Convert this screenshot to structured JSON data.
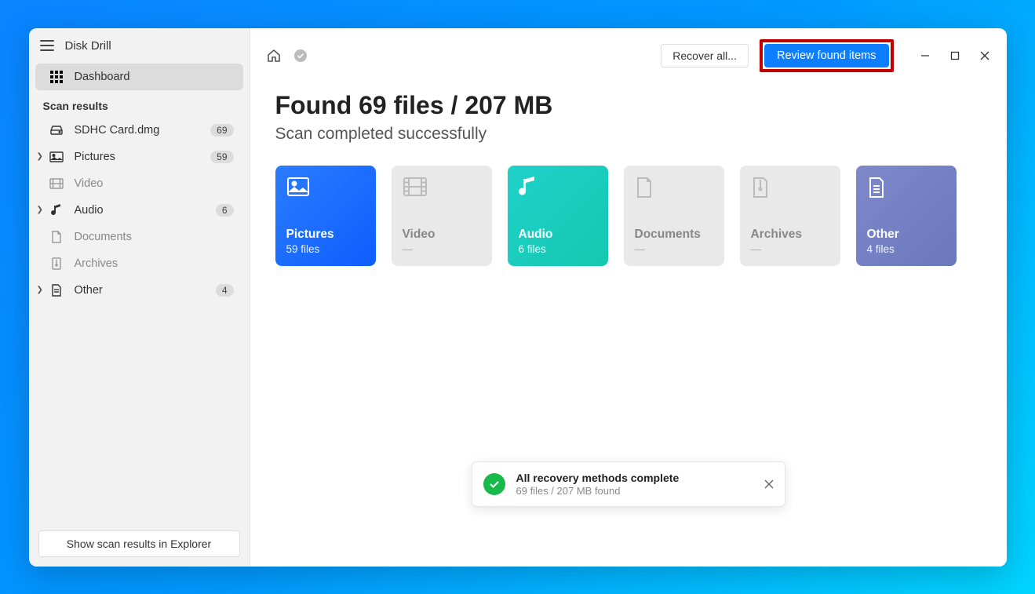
{
  "app": {
    "title": "Disk Drill"
  },
  "sidebar": {
    "dashboard_label": "Dashboard",
    "section_title": "Scan results",
    "items": [
      {
        "label": "SDHC Card.dmg",
        "count": "69",
        "expandable": false
      },
      {
        "label": "Pictures",
        "count": "59",
        "expandable": true
      },
      {
        "label": "Video",
        "count": "",
        "expandable": false
      },
      {
        "label": "Audio",
        "count": "6",
        "expandable": true
      },
      {
        "label": "Documents",
        "count": "",
        "expandable": false
      },
      {
        "label": "Archives",
        "count": "",
        "expandable": false
      },
      {
        "label": "Other",
        "count": "4",
        "expandable": true
      }
    ],
    "explorer_button": "Show scan results in Explorer"
  },
  "topbar": {
    "recover_label": "Recover all...",
    "review_label": "Review found items"
  },
  "results": {
    "heading": "Found 69 files / 207 MB",
    "subheading": "Scan completed successfully",
    "categories": [
      {
        "title": "Pictures",
        "sub": "59 files",
        "style": "pictures"
      },
      {
        "title": "Video",
        "sub": "—",
        "style": "disabled"
      },
      {
        "title": "Audio",
        "sub": "6 files",
        "style": "audio"
      },
      {
        "title": "Documents",
        "sub": "—",
        "style": "disabled"
      },
      {
        "title": "Archives",
        "sub": "—",
        "style": "disabled"
      },
      {
        "title": "Other",
        "sub": "4 files",
        "style": "other"
      }
    ]
  },
  "toast": {
    "title": "All recovery methods complete",
    "subtitle": "69 files / 207 MB found"
  }
}
